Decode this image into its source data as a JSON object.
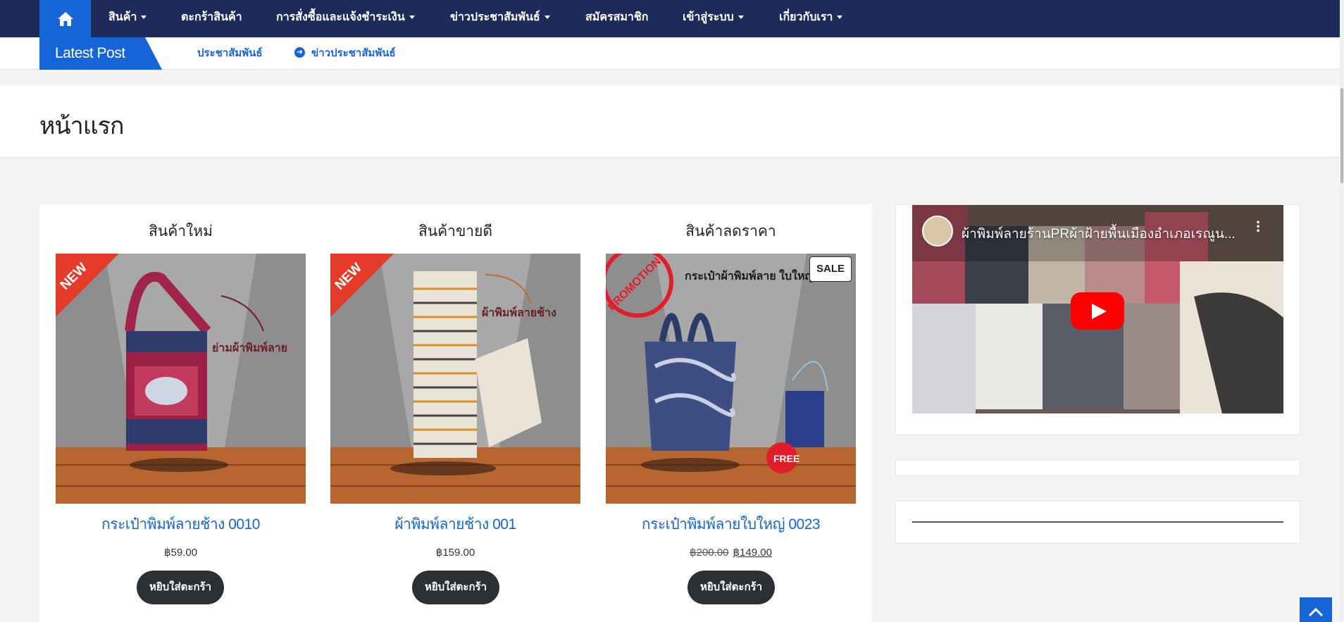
{
  "nav": {
    "items": [
      {
        "label": "สินค้า",
        "dropdown": true
      },
      {
        "label": "ตะกร้าสินค้า",
        "dropdown": false
      },
      {
        "label": "การสั่งซื้อและแจ้งชำระเงิน",
        "dropdown": true
      },
      {
        "label": "ข่าวประชาสัมพันธ์",
        "dropdown": true
      },
      {
        "label": "สมัครสมาชิก",
        "dropdown": false
      },
      {
        "label": "เข้าสู่ระบบ",
        "dropdown": true
      },
      {
        "label": "เกี่ยวกับเรา",
        "dropdown": true
      }
    ],
    "home_icon": "home-icon"
  },
  "latest": {
    "tag": "Latest Post",
    "links": [
      "ประชาสัมพันธ์",
      "ข่าวประชาสัมพันธ์"
    ]
  },
  "page": {
    "title": "หน้าแรก"
  },
  "products": [
    {
      "column_title": "สินค้าใหม่",
      "name": "กระเป๋าพิมพ์ลายช้าง 0010",
      "price": "฿59.00",
      "old_price": "",
      "button": "หยิบใส่ตะกร้า",
      "ribbon": "NEW",
      "image_caption": "ย่ามผ้าพิมพ์ลาย",
      "sale": false
    },
    {
      "column_title": "สินค้าขายดี",
      "name": "ผ้าพิมพ์ลายช้าง 001",
      "price": "฿159.00",
      "old_price": "",
      "button": "หยิบใส่ตะกร้า",
      "ribbon": "NEW",
      "image_caption": "ผ้าพิมพ์ลายช้าง",
      "sale": false
    },
    {
      "column_title": "สินค้าลดราคา",
      "name": "กระเป๋าพิมพ์ลายใบใหญ่ 0023",
      "price": "฿149.00",
      "old_price": "฿200.00",
      "button": "หยิบใส่ตะกร้า",
      "ribbon": "PROMOTION",
      "image_caption": "กระเป๋าผ้าพิมพ์ลาย ใบใหญ่",
      "sale": true,
      "sale_label": "SALE",
      "free_label": "FREE"
    }
  ],
  "video": {
    "title": "ผ้าพิมพ์ลายร้านPRผ้าฝ้ายพื้นเมืองอำเภอเรณูน...",
    "menu_icon": "more-vert-icon",
    "play_icon": "play-icon"
  },
  "colors": {
    "nav_bg": "#1d2b5a",
    "accent": "#1565d8",
    "button_dark": "#2c2f33"
  }
}
